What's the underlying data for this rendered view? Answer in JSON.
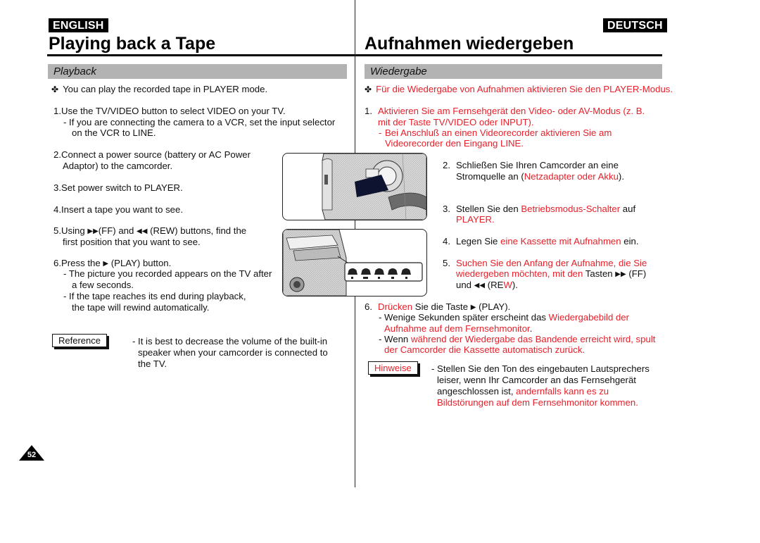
{
  "header": {
    "left_badge": "ENGLISH",
    "right_badge": "DEUTSCH",
    "left_title": "Playing back a Tape",
    "right_title": "Aufnahmen wiedergeben"
  },
  "english": {
    "section": "Playback",
    "intro": "You can play the recorded tape in PLAYER mode.",
    "step1": "1.Use the TV/VIDEO button to select VIDEO on your TV.",
    "step1_sub_line1": "-  If you are connecting the camera to a VCR, set the input selector",
    "step1_sub_line2": "on the VCR to LINE.",
    "step2_line1": "2.Connect a power source (battery or AC Power",
    "step2_line2": "Adaptor) to the camcorder.",
    "step3": "3.Set power switch to PLAYER.",
    "step4": "4.Insert a tape you want to see.",
    "step5_a": "5.Using",
    "step5_b": "(FF) and",
    "step5_c": "(REW) buttons, find the",
    "step5_line2": "first position that you want to see.",
    "step6_a": "6.Press the",
    "step6_b": "(PLAY) button.",
    "step6_sub1_line1": "-  The picture you recorded appears on the TV  after",
    "step6_sub1_line2": "a few seconds.",
    "step6_sub2_line1": "-  If the tape reaches its end during playback,",
    "step6_sub2_line2": "the tape will rewind automatically.",
    "reference_label": "Reference",
    "reference_line1": "- It is best to decrease the volume of the built-in",
    "reference_line2": "speaker when your camcorder is connected to",
    "reference_line3": "the TV."
  },
  "deutsch": {
    "section": "Wiedergabe",
    "intro": "Für die Wiedergabe von Aufnahmen aktivieren Sie den PLAYER-Modus.",
    "step1_num": "1.",
    "step1_line1": "Aktivieren Sie am Fernsehgerät den Video- oder AV-Modus (z. B.",
    "step1_line2": "mit der Taste TV/VIDEO oder INPUT).",
    "step1_sub_dash": "-",
    "step1_sub_line1": "Bei Anschluß an einen Videorecorder aktivieren Sie am",
    "step1_sub_line2": "Videorecorder den Eingang LINE.",
    "step2_num": "2.",
    "step2_line1": "Schließen Sie Ihren Camcorder an eine",
    "step2_line2_a": "Stromquelle an (",
    "step2_line2_b": "Netzadapter oder Akku",
    "step2_line2_c": ").",
    "step3_num": "3.",
    "step3_line1_a": "Stellen Sie den ",
    "step3_line1_b": "Betriebsmodus-Schalter",
    "step3_line1_c": " auf",
    "step3_line2": "PLAYER.",
    "step4_num": "4.",
    "step4_a": "Legen Sie ",
    "step4_b": "eine Kassette mit Aufnahmen",
    "step4_c": " ein.",
    "step5_num": "5.",
    "step5_line1": "Suchen Sie den Anfang der Aufnahme, die Sie",
    "step5_line2_a": "wiedergeben möchten, mit den",
    "step5_line2_b": " Tasten ",
    "step5_line2_c": " (FF)",
    "step5_line3_a": "und ",
    "step5_line3_b": " (RE",
    "step5_line3_c": "W",
    "step5_line3_d": ").",
    "step6_num": "6.",
    "step6_a": "Drücken",
    "step6_b": " Sie die Taste ",
    "step6_c": " (PLAY).",
    "step6_sub1_a": "- Wenige Sekunden später erscheint das ",
    "step6_sub1_b": "Wiedergabebild der",
    "step6_sub1_line2": "Aufnahme auf dem Fernsehmonitor",
    "step6_sub1_line2_end": ".",
    "step6_sub2_a": "- Wenn ",
    "step6_sub2_b": "während der Wiedergabe das Bandende erreicht wird, spult",
    "step6_sub2_line2": "der Camcorder die Kassette automatisch zurück.",
    "hint_label": "Hinweise",
    "hint_line1": "- Stellen Sie den Ton des eingebauten Lautsprechers",
    "hint_line2": "leiser, wenn Ihr Camcorder an das Fernsehgerät",
    "hint_line3_a": "angeschlossen ist, ",
    "hint_line3_b": "andernfalls kann es zu",
    "hint_line4": "Bildstörungen auf dem Fernsehmonitor kommen."
  },
  "icons": {
    "bullet": "✤",
    "ff": "▶▶",
    "rew": "◀◀",
    "play": "▶"
  },
  "page_number": "52",
  "colors": {
    "accent_red": "#e8202a",
    "section_gray": "#b3b3b3"
  }
}
